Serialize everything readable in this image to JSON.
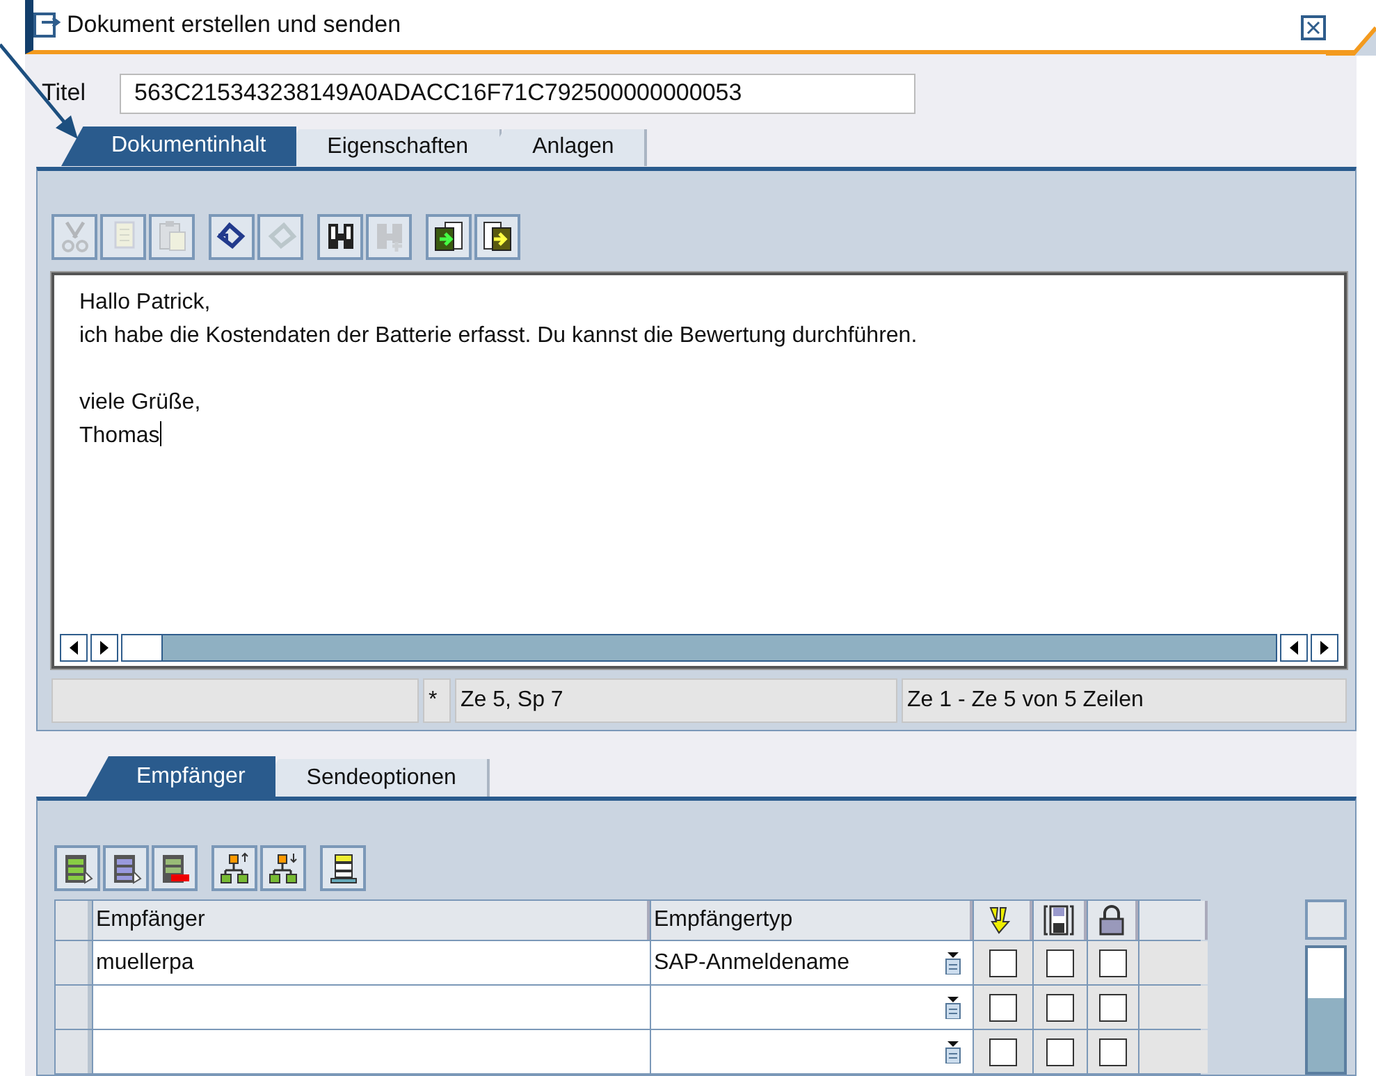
{
  "window": {
    "title": "Dokument erstellen und senden"
  },
  "title_field": {
    "label": "Titel",
    "value": "563C215343238149A0ADACC16F71C792500000000053"
  },
  "document_tabs": [
    {
      "label": "Dokumentinhalt",
      "selected": true
    },
    {
      "label": "Eigenschaften",
      "selected": false
    },
    {
      "label": "Anlagen",
      "selected": false
    }
  ],
  "editor_toolbar": [
    [
      {
        "kind": "cut",
        "disabled": true
      },
      {
        "kind": "copy",
        "disabled": true
      },
      {
        "kind": "paste",
        "disabled": true
      }
    ],
    [
      {
        "kind": "undo",
        "disabled": false
      },
      {
        "kind": "redo",
        "disabled": true
      }
    ],
    [
      {
        "kind": "find",
        "disabled": false
      },
      {
        "kind": "find-next",
        "disabled": true
      }
    ],
    [
      {
        "kind": "import",
        "disabled": false
      },
      {
        "kind": "export",
        "disabled": false
      }
    ]
  ],
  "editor": {
    "paragraphs": [
      [
        "Hallo Patrick,",
        "ich habe die Kostendaten der Batterie erfasst. Du kannst die Bewertung durchführen."
      ],
      [
        "viele Grüße,",
        "Thomas"
      ]
    ]
  },
  "status_bar": {
    "modified": "*",
    "cursor": "Ze 5, Sp 7",
    "range": "Ze 1 - Ze 5 von 5 Zeilen"
  },
  "recipient_tabs": [
    {
      "label": "Empfänger",
      "selected": true
    },
    {
      "label": "Sendeoptionen",
      "selected": false
    }
  ],
  "recipient_toolbar": [
    [
      {
        "kind": "append-row"
      },
      {
        "kind": "insert-row"
      },
      {
        "kind": "delete-row"
      }
    ],
    [
      {
        "kind": "move-up"
      },
      {
        "kind": "move-down"
      }
    ],
    [
      {
        "kind": "layout"
      }
    ]
  ],
  "table": {
    "columns": [
      {
        "kind": "text",
        "label": "Empfänger"
      },
      {
        "kind": "text",
        "label": "Empfängertyp"
      },
      {
        "kind": "express"
      },
      {
        "kind": "copy"
      },
      {
        "kind": "lock"
      }
    ],
    "rows": [
      {
        "recipient": "muellerpa",
        "type": "SAP-Anmeldename",
        "options": [
          {
            "checked": false
          },
          {
            "checked": false
          },
          {
            "checked": false
          }
        ]
      },
      {
        "options": [
          {
            "checked": false
          },
          {
            "checked": false
          },
          {
            "checked": false
          }
        ]
      },
      {
        "options": [
          {
            "checked": false
          },
          {
            "checked": false
          },
          {
            "checked": false
          }
        ]
      }
    ]
  }
}
